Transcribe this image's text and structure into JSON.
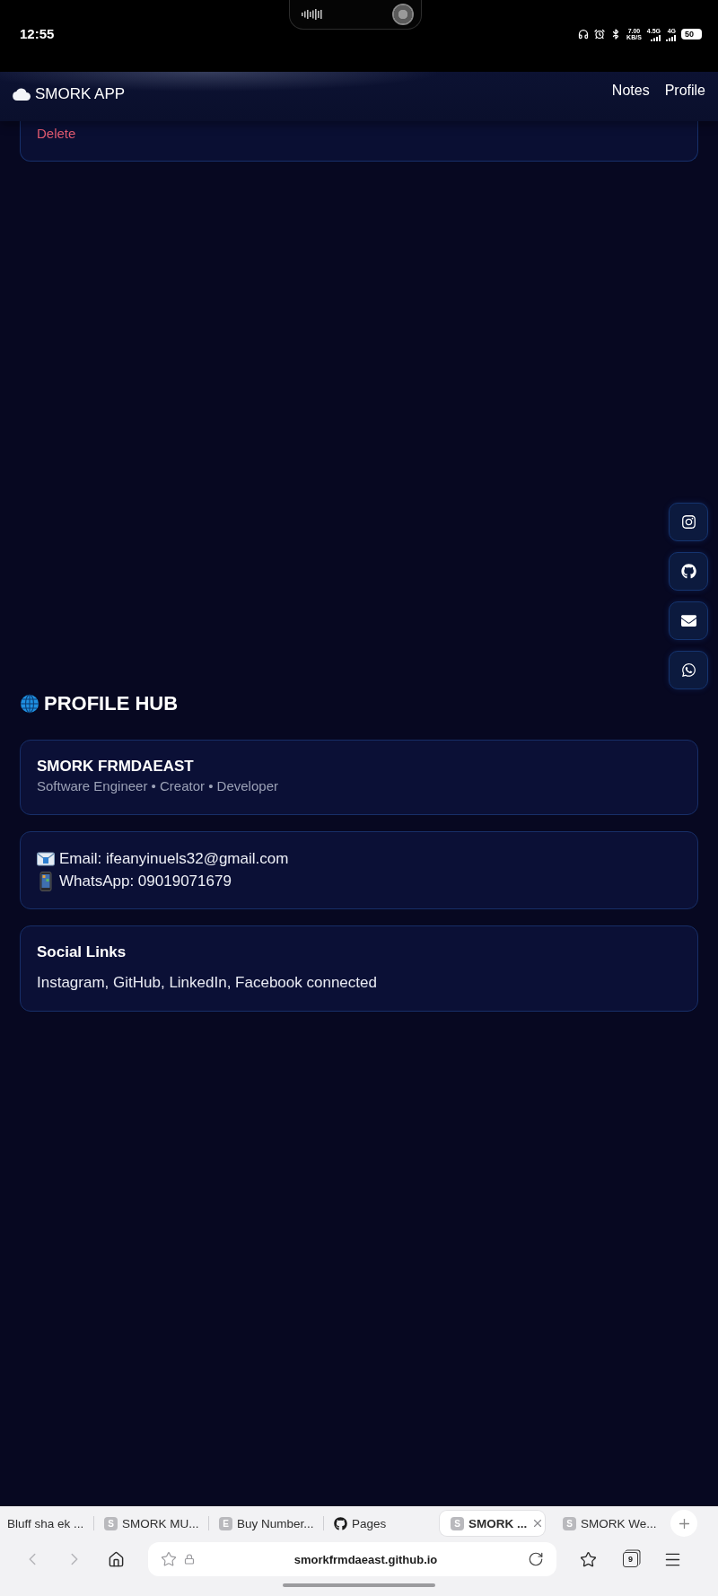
{
  "status_bar": {
    "time": "12:55",
    "speed": "7.00",
    "speed_unit": "KB/S",
    "networks": [
      "4.5G",
      "4G"
    ],
    "battery": "50"
  },
  "header": {
    "brand": "SMORK APP",
    "nav": [
      {
        "label": "Notes"
      },
      {
        "label": "Profile"
      }
    ]
  },
  "note_card": {
    "action": "Delete"
  },
  "social_buttons": [
    {
      "kind": "instagram"
    },
    {
      "kind": "github"
    },
    {
      "kind": "email"
    },
    {
      "kind": "whatsapp"
    }
  ],
  "profile_hub": {
    "title": "PROFILE HUB",
    "name": "SMORK FRMDAEAST",
    "tagline": "Software Engineer • Creator • Developer",
    "contacts": [
      {
        "kind": "email",
        "text": "Email: ifeanyinuels32@gmail.com"
      },
      {
        "kind": "phone",
        "text": "WhatsApp: 09019071679"
      }
    ],
    "social": {
      "heading": "Social Links",
      "text": "Instagram, GitHub, LinkedIn, Facebook connected"
    }
  },
  "browser": {
    "tabs": [
      {
        "title": "Bluff sha ek ...",
        "kind": "plain",
        "selected": false
      },
      {
        "title": "SMORK MU...",
        "kind": "letter",
        "letter": "S",
        "selected": false
      },
      {
        "title": "Buy Number...",
        "kind": "letter",
        "letter": "E",
        "selected": false
      },
      {
        "title": "Pages",
        "kind": "github",
        "selected": false
      },
      {
        "title": "SMORK ...",
        "kind": "letter",
        "letter": "S",
        "selected": true
      },
      {
        "title": "SMORK We...",
        "kind": "letter",
        "letter": "S",
        "selected": false
      }
    ],
    "url": "smorkfrmdaeast.github.io",
    "tab_count": "9"
  }
}
